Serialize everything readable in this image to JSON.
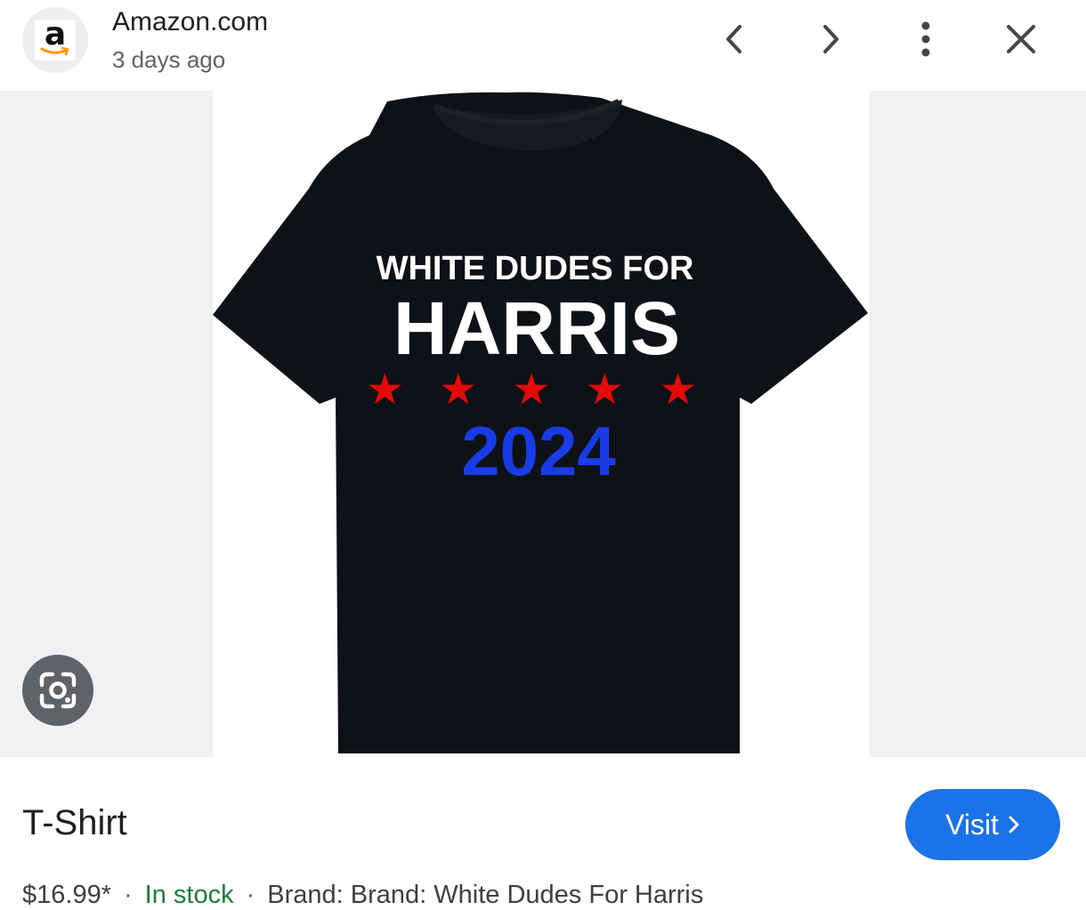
{
  "header": {
    "source_name": "Amazon.com",
    "source_time": "3 days ago",
    "logo_letter": "a",
    "icons": [
      "back-chevron-icon",
      "forward-chevron-icon",
      "more-vert-icon",
      "close-icon"
    ]
  },
  "product_image": {
    "shirt_lines": {
      "line1": "WHITE DUDES FOR",
      "line2": "HARRIS",
      "line3": "2024",
      "stars": "★ ★ ★ ★ ★"
    },
    "colors": {
      "shirt": "#0e1216",
      "text_white": "#ffffff",
      "stars_red": "#e50a0a",
      "year_blue": "#1a3ce6"
    }
  },
  "lens_button": {
    "icon": "google-lens-icon"
  },
  "product": {
    "title": "T-Shirt",
    "visit_label": "Visit",
    "price": "$16.99*",
    "stock": "In stock",
    "brand": "Brand: Brand: White Dudes For Harris"
  },
  "colors": {
    "accent": "#1a73e8",
    "stock_green": "#188038",
    "muted": "#5f6368",
    "image_bg": "#f0f1f3"
  }
}
